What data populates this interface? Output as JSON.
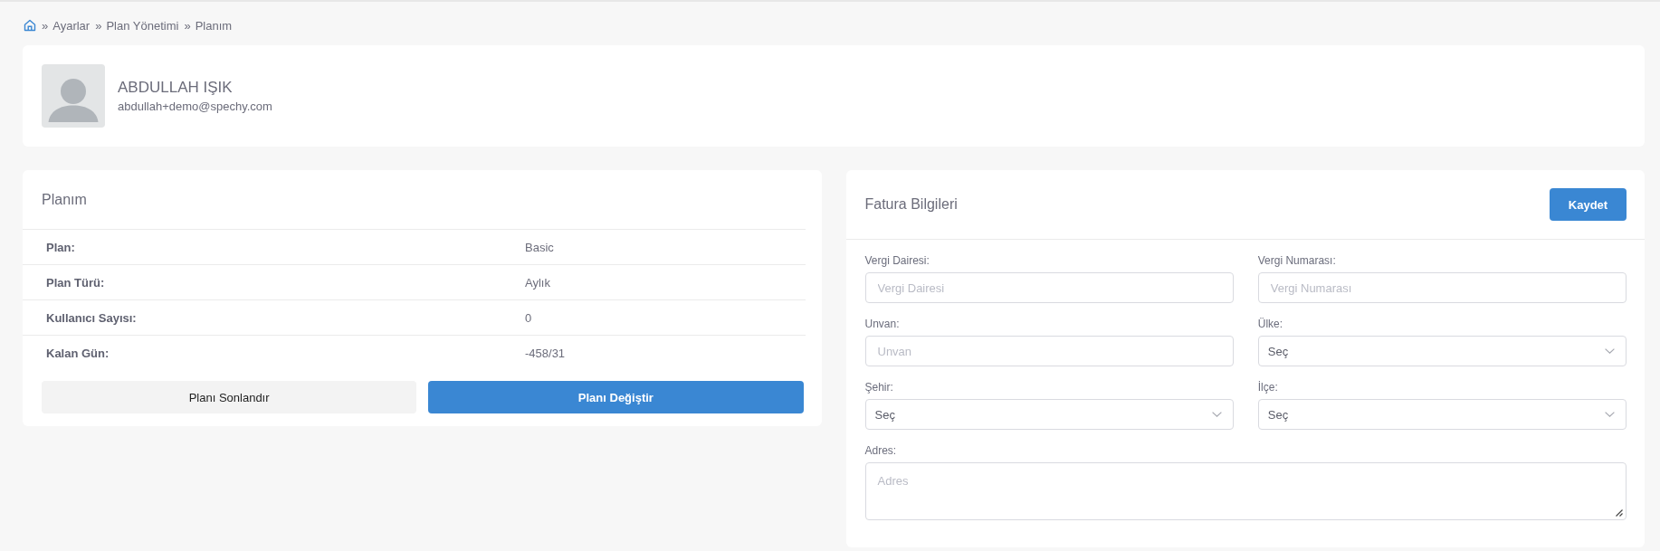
{
  "breadcrumb": [
    {
      "separator": "»",
      "label": "Ayarlar"
    },
    {
      "separator": "»",
      "label": "Plan Yönetimi"
    },
    {
      "separator": "»",
      "label": "Planım"
    }
  ],
  "profile": {
    "name": "ABDULLAH IŞIK",
    "email": "abdullah+demo@spechy.com"
  },
  "plan_card": {
    "title": "Planım",
    "rows": [
      {
        "label": "Plan:",
        "value": "Basic"
      },
      {
        "label": "Plan Türü:",
        "value": "Aylık"
      },
      {
        "label": "Kullanıcı Sayısı:",
        "value": "0"
      },
      {
        "label": "Kalan Gün:",
        "value": "-458/31"
      }
    ],
    "buttons": [
      {
        "label": "Planı Sonlandır",
        "kind": "secondary"
      },
      {
        "label": "Planı Değiştir",
        "kind": "primary"
      }
    ]
  },
  "billing_card": {
    "title": "Fatura Bilgileri",
    "save_button": "Kaydet",
    "fields": [
      {
        "label": "Vergi Dairesi:",
        "kind": "input",
        "placeholder": "Vergi Dairesi"
      },
      {
        "label": "Vergi Numarası:",
        "kind": "input",
        "placeholder": "Vergi Numarası"
      },
      {
        "label": "Unvan:",
        "kind": "input",
        "placeholder": "Unvan"
      },
      {
        "label": "Ülke:",
        "kind": "select",
        "value": "Seç"
      },
      {
        "label": "Şehir:",
        "kind": "select",
        "value": "Seç"
      },
      {
        "label": "İlçe:",
        "kind": "select",
        "value": "Seç"
      },
      {
        "label": "Adres:",
        "kind": "textarea",
        "placeholder": "Adres"
      }
    ]
  }
}
